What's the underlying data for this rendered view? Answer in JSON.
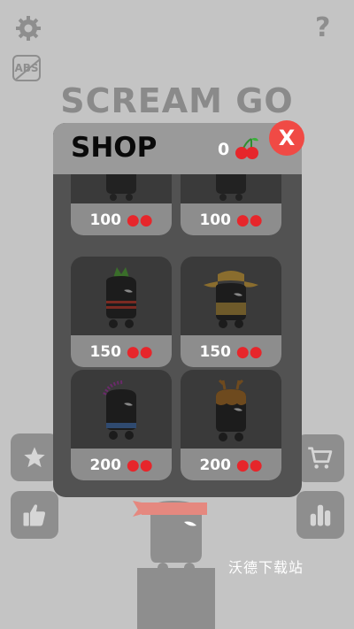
{
  "title": "SCREAM GO",
  "abs_label": "ABS",
  "help_label": "?",
  "shop": {
    "title": "SHOP",
    "cherry_count": "0",
    "close_label": "X",
    "items": [
      {
        "price": "100",
        "character": "partial-top-left"
      },
      {
        "price": "100",
        "character": "partial-top-right"
      },
      {
        "price": "150",
        "character": "pineapple-hat"
      },
      {
        "price": "150",
        "character": "cowboy-hat"
      },
      {
        "price": "200",
        "character": "purple-mohawk"
      },
      {
        "price": "200",
        "character": "antler-hat"
      }
    ]
  },
  "side_buttons": {
    "left": [
      "star-icon",
      "thumbs-up-icon"
    ],
    "right": [
      "cart-icon",
      "leaderboard-icon"
    ]
  },
  "watermark": "沃德下载站",
  "colors": {
    "close": "#f04a45",
    "cherry": "#e6262b",
    "background": "#c4c4c4"
  }
}
